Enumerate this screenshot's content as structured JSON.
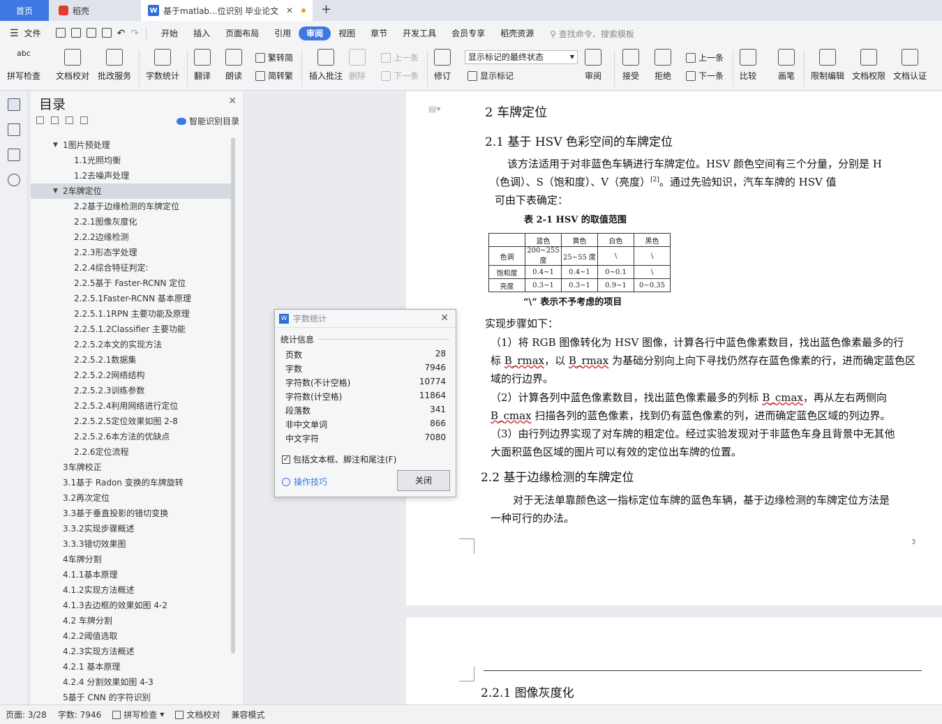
{
  "tabs": {
    "home": "首页",
    "daoke": "稻壳",
    "doc": "基于matlab...位识别 毕业论文",
    "new_tab": "+"
  },
  "menu": {
    "file": "文件",
    "items": [
      "开始",
      "插入",
      "页面布局",
      "引用",
      "审阅",
      "视图",
      "章节",
      "开发工具",
      "会员专享",
      "稻壳资源"
    ],
    "active": "审阅",
    "search": "查找命令、搜索模板"
  },
  "ribbon": {
    "spell": "拼写检查",
    "proof": "文档校对",
    "correction": "批改服务",
    "wordcount": "字数统计",
    "translate": "翻译",
    "read": "朗读",
    "trad": "繁转简",
    "simp": "简转繁",
    "insert_comment": "插入批注",
    "delete": "删除",
    "prev": "上一条",
    "next": "下一条",
    "revise": "修订",
    "markup_select": "显示标记的最终状态",
    "show_markup": "显示标记",
    "review": "审阅",
    "accept": "接受",
    "reject": "拒绝",
    "prev2": "上一条",
    "next2": "下一条",
    "compare": "比较",
    "pen": "画笔",
    "restrict": "限制编辑",
    "perm": "文档权限",
    "certify": "文档认证",
    "abc": "abc"
  },
  "toc": {
    "title": "目录",
    "ai_label": "智能识别目录",
    "items": [
      {
        "text": "1图片预处理",
        "level": 1,
        "caret": "down"
      },
      {
        "text": "1.1光照均衡",
        "level": 2
      },
      {
        "text": "1.2去噪声处理",
        "level": 2
      },
      {
        "text": "2车牌定位",
        "level": 1,
        "caret": "down",
        "selected": true
      },
      {
        "text": "2.2基于边缘检测的车牌定位",
        "level": 2
      },
      {
        "text": "2.2.1图像灰度化",
        "level": 2
      },
      {
        "text": "2.2.2边缘检测",
        "level": 2
      },
      {
        "text": "2.2.3形态学处理",
        "level": 2
      },
      {
        "text": "2.2.4综合特征判定:",
        "level": 2
      },
      {
        "text": "2.2.5基于 Faster-RCNN 定位",
        "level": 2
      },
      {
        "text": "2.2.5.1Faster-RCNN 基本原理",
        "level": 2
      },
      {
        "text": "2.2.5.1.1RPN 主要功能及原理",
        "level": 2
      },
      {
        "text": "2.2.5.1.2Classifier 主要功能",
        "level": 2
      },
      {
        "text": "2.2.5.2本文的实现方法",
        "level": 2
      },
      {
        "text": "2.2.5.2.1数据集",
        "level": 2
      },
      {
        "text": "2.2.5.2.2网络结构",
        "level": 2
      },
      {
        "text": "2.2.5.2.3训练参数",
        "level": 2
      },
      {
        "text": "2.2.5.2.4利用网络进行定位",
        "level": 2
      },
      {
        "text": "2.2.5.2.5定位效果如图 2-8",
        "level": 2
      },
      {
        "text": "2.2.5.2.6本方法的优缺点",
        "level": 2
      },
      {
        "text": "2.2.6定位流程",
        "level": 2
      },
      {
        "text": "3车牌校正",
        "level": 1
      },
      {
        "text": "3.1基于 Radon 变换的车牌旋转",
        "level": 1
      },
      {
        "text": "3.2再次定位",
        "level": 1
      },
      {
        "text": "3.3基于垂直投影的错切变换",
        "level": 1
      },
      {
        "text": "3.3.2实现步骤概述",
        "level": 1
      },
      {
        "text": "3.3.3错切效果图",
        "level": 1
      },
      {
        "text": "4车牌分割",
        "level": 1
      },
      {
        "text": "4.1.1基本原理",
        "level": 1
      },
      {
        "text": "4.1.2实现方法概述",
        "level": 1
      },
      {
        "text": "4.1.3去边框的效果如图 4-2",
        "level": 1
      },
      {
        "text": "4.2 车牌分割",
        "level": 1
      },
      {
        "text": "4.2.2阈值选取",
        "level": 1
      },
      {
        "text": "4.2.3实现方法概述",
        "level": 1
      },
      {
        "text": "4.2.1 基本原理",
        "level": 1
      },
      {
        "text": "4.2.4 分割效果如图 4-3",
        "level": 1
      },
      {
        "text": "5基于 CNN 的字符识别",
        "level": 1
      }
    ]
  },
  "doc": {
    "h_chapter": "2   车牌定位",
    "h_21": "2.1  基于 HSV 色彩空间的车牌定位",
    "p1a": "该方法适用于对非蓝色车辆进行车牌定位。HSV 颜色空间有三个分量，分别是 H",
    "p1b": "（色调）、S（饱和度）、V（亮度）",
    "p1b_ref": "[2]",
    "p1b_tail": "。通过先验知识，汽车车牌的  HSV 值",
    "p1c": "可由下表确定：",
    "table_caption": "表  2-1  HSV 的取值范围",
    "table": {
      "header": [
        "",
        "蓝色",
        "黄色",
        "白色",
        "黑色"
      ],
      "rows": [
        [
          "色调",
          "200~255 度",
          "25~55 度",
          "\\",
          "\\"
        ],
        [
          "饱和度",
          "0.4~1",
          "0.4~1",
          "0~0.1",
          "\\"
        ],
        [
          "亮度",
          "0.3~1",
          "0.3~1",
          "0.9~1",
          "0~0.35"
        ]
      ]
    },
    "table_note": "“\\” 表示不予考虑的项目",
    "steps_intro": "实现步骤如下：",
    "s1a": "（1）将 RGB 图像转化为  HSV 图像，计算各行中蓝色像素数目，找出蓝色像素最多的行",
    "s1b_pre": "标 ",
    "s1b_u1": "B_rmax",
    "s1b_mid": "，以 ",
    "s1b_u2": "B_rmax",
    "s1b_post": " 为基础分别向上向下寻找仍然存在蓝色像素的行，进而确定蓝色区",
    "s1c": "域的行边界。",
    "s2a_pre": "（2）计算各列中蓝色像素数目，找出蓝色像素最多的列标  ",
    "s2a_u": "B_cmax",
    "s2a_post": "，再从左右两侧向",
    "s2b_u": "B_cmax",
    "s2b_post": " 扫描各列的蓝色像素，找到仍有蓝色像素的列，进而确定蓝色区域的列边界。",
    "s3a": "（3）由行列边界实现了对车牌的粗定位。经过实验发现对于非蓝色车身且背景中无其他",
    "s3b": "大面积蓝色区域的图片可以有效的定位出车牌的位置。",
    "h_22": "2.2  基于边缘检测的车牌定位",
    "p2a": "对于无法单靠颜色这一指标定位车牌的蓝色车辆，基于边缘检测的车牌定位方法是",
    "p2b": "一种可行的办法。",
    "page_no": "3",
    "h_221": "2.2.1  图像灰度化"
  },
  "dialog": {
    "title": "字数统计",
    "section": "统计信息",
    "rows": [
      [
        "页数",
        "28"
      ],
      [
        "字数",
        "7946"
      ],
      [
        "字符数(不计空格)",
        "10774"
      ],
      [
        "字符数(计空格)",
        "11864"
      ],
      [
        "段落数",
        "341"
      ],
      [
        "非中文单词",
        "866"
      ],
      [
        "中文字符",
        "7080"
      ]
    ],
    "checkbox": "包括文本框、脚注和尾注(F)",
    "checkbox_checked": true,
    "tips": "操作技巧",
    "close": "关闭"
  },
  "status": {
    "page": "页面: 3/28",
    "words": "字数: 7946",
    "spell": "拼写检查",
    "proof": "文档校对",
    "compat": "兼容模式"
  }
}
